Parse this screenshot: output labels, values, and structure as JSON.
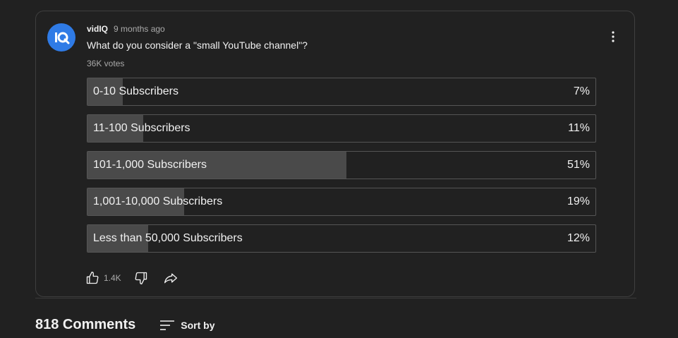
{
  "post": {
    "author": "vidIQ",
    "time": "9 months ago",
    "question": "What do you consider a \"small YouTube channel\"?",
    "votes": "36K votes",
    "avatar_icon": "vidiq-logo-icon",
    "avatar_color": "#2f7be6"
  },
  "poll": {
    "options": [
      {
        "label": "0-10 Subscribers",
        "percent_text": "7%",
        "percent": 7
      },
      {
        "label": "11-100 Subscribers",
        "percent_text": "11%",
        "percent": 11
      },
      {
        "label": "101-1,000 Subscribers",
        "percent_text": "51%",
        "percent": 51
      },
      {
        "label": "1,001-10,000 Subscribers",
        "percent_text": "19%",
        "percent": 19
      },
      {
        "label": "Less than 50,000 Subscribers",
        "percent_text": "12%",
        "percent": 12
      }
    ]
  },
  "actions": {
    "like_count": "1.4K",
    "like_icon": "thumbs-up-icon",
    "dislike_icon": "thumbs-down-icon",
    "share_icon": "share-icon",
    "menu_icon": "more-vertical-icon"
  },
  "comments": {
    "count_label": "818 Comments",
    "sort_label": "Sort by",
    "sort_icon": "sort-icon"
  }
}
